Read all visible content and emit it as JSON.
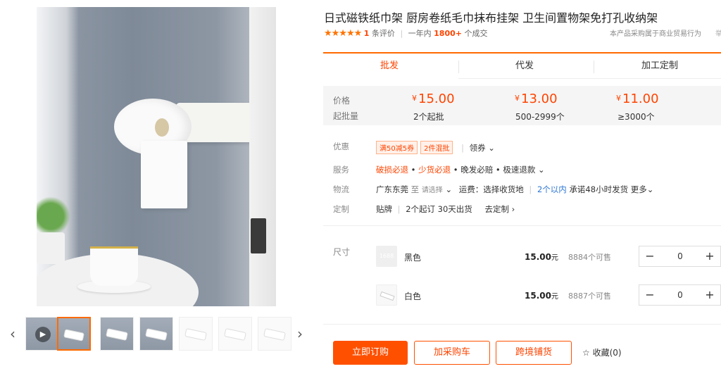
{
  "product": {
    "title": "日式磁铁纸巾架 厨房卷纸毛巾抹布挂架 卫生间置物架免打孔收纳架",
    "stars": "★★★★★",
    "review_count": "1",
    "review_suffix": "条评价",
    "sold_prefix": "一年内",
    "sold_count": "1800+",
    "sold_suffix": "个成交",
    "trade_note": "本产品采购属于商业贸易行为",
    "trade_note_cut": "举"
  },
  "gallery": {
    "prev_icon": "‹",
    "next_icon": "›",
    "thumbs": [
      "video",
      "selected",
      "img3",
      "img4",
      "img5",
      "img6",
      "img7"
    ]
  },
  "tabs": [
    {
      "label": "批发"
    },
    {
      "label": "代发"
    },
    {
      "label": "加工定制"
    }
  ],
  "pricing": {
    "price_label": "价格",
    "qty_label": "起批量",
    "currency": "¥",
    "tiers": [
      {
        "price": "15.00",
        "qty": "2个起批"
      },
      {
        "price": "13.00",
        "qty": "500-2999个"
      },
      {
        "price": "11.00",
        "qty": "≥3000个"
      }
    ]
  },
  "offers": {
    "label": "优惠",
    "tags": [
      "满50减5券",
      "2件混批"
    ],
    "coupon_link": "领券 ⌄"
  },
  "service": {
    "label": "服务",
    "item1": "破损必退",
    "item2": "少货必退",
    "item3": "晚发必赔",
    "item4": "极速退款",
    "dot": "•",
    "more": "⌄"
  },
  "logistics": {
    "label": "物流",
    "origin": "广东东莞",
    "to": "至",
    "select_placeholder": "请选择",
    "chevron": "⌄",
    "fee_label": "运费：选择收货地",
    "within": "2个以内",
    "promise": "承诺48小时发货",
    "more": "更多⌄"
  },
  "custom": {
    "label": "定制",
    "type": "贴牌",
    "min": "2个起订",
    "lead": "30天出货",
    "link": "去定制 ›"
  },
  "sku": {
    "label": "尺寸",
    "swatch_text": "1688",
    "price_unit": "元",
    "minus": "−",
    "plus": "+",
    "items": [
      {
        "name": "黑色",
        "price": "15.00",
        "stock": "8884个可售",
        "qty": "0"
      },
      {
        "name": "白色",
        "price": "15.00",
        "stock": "8887个可售",
        "qty": "0"
      }
    ]
  },
  "actions": {
    "buy_now": "立即订购",
    "add_cart": "加采购车",
    "cross_border": "跨境铺货",
    "favorite": "收藏(0)",
    "favorite_icon": "☆"
  }
}
